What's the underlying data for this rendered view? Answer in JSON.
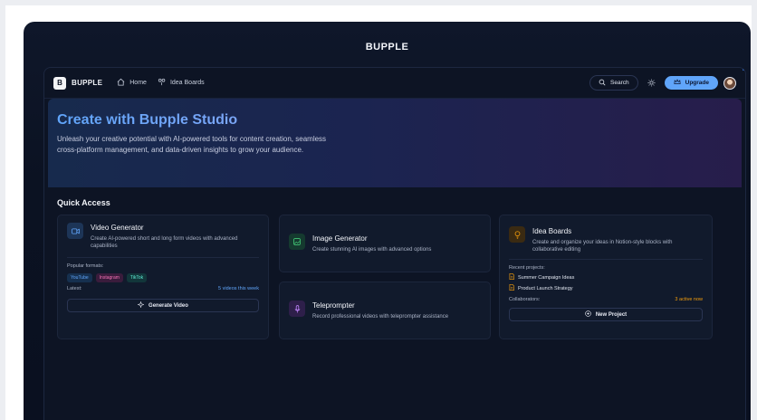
{
  "device": {
    "title": "BUPPLE"
  },
  "nav": {
    "logo_letter": "B",
    "brand": "BUPPLE",
    "links": [
      {
        "label": "Home",
        "icon": "home-icon"
      },
      {
        "label": "Idea Boards",
        "icon": "idea-boards-icon"
      }
    ],
    "search_label": "Search",
    "upgrade_label": "Upgrade"
  },
  "hero": {
    "title": "Create with Bupple Studio",
    "description": "Unleash your creative potential with AI-powered tools for content creation, seamless cross-platform management, and data-driven insights to grow your audience."
  },
  "quick_access": {
    "title": "Quick Access",
    "video": {
      "title": "Video Generator",
      "description": "Create AI-powered short and long form videos with advanced capabilities",
      "formats_label": "Popular formats:",
      "formats": [
        "YouTube",
        "Instagram",
        "TikTok"
      ],
      "latest_label": "Latest:",
      "latest_value": "5 videos this week",
      "button": "Generate Video"
    },
    "image": {
      "title": "Image Generator",
      "description": "Create stunning AI images with advanced options"
    },
    "teleprompter": {
      "title": "Teleprompter",
      "description": "Record professional videos with teleprompter assistance"
    },
    "idea": {
      "title": "Idea Boards",
      "description": "Create and organize your ideas in Notion-style blocks with collaborative editing",
      "recent_label": "Recent projects:",
      "projects": [
        "Summer Campaign Ideas",
        "Product Launch Strategy"
      ],
      "collab_label": "Collaborators:",
      "collab_value": "3 active now",
      "button": "New Project"
    }
  },
  "colors": {
    "accent": "#60a5fa",
    "youtube_tag": "#60a5fa",
    "instagram_tag": "#f472b6",
    "tiktok_tag": "#5eead4",
    "highlight": "#f59e0b"
  }
}
